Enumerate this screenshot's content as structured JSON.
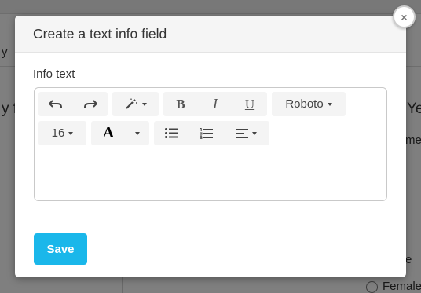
{
  "background": {
    "left_text": "y",
    "left_heading": "y fi",
    "right_heading": "Ye",
    "right_sub": "me",
    "right_label": "e",
    "radio_label": "Female"
  },
  "modal": {
    "title": "Create a text info field",
    "close_glyph": "×",
    "field_label": "Info text",
    "save_label": "Save"
  },
  "toolbar": {
    "font_name": "Roboto",
    "font_size": "16",
    "color_letter": "A",
    "bold": "B",
    "italic": "I",
    "underline": "U",
    "icons": [
      "undo-icon",
      "redo-icon",
      "magic-wand-icon",
      "bold-icon",
      "italic-icon",
      "underline-icon",
      "text-color-icon",
      "unordered-list-icon",
      "ordered-list-icon",
      "align-left-icon"
    ]
  },
  "colors": {
    "accent": "#1ab7ea",
    "overlay": "rgba(0,0,0,0.5)"
  }
}
